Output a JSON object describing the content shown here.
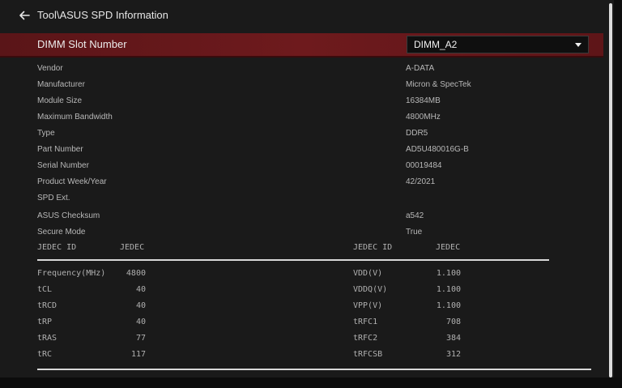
{
  "header": {
    "title": "Tool\\ASUS SPD Information"
  },
  "slot": {
    "label": "DIMM Slot Number",
    "selected": "DIMM_A2"
  },
  "info": [
    {
      "label": "Vendor",
      "value": "A-DATA"
    },
    {
      "label": "Manufacturer",
      "value": "Micron & SpecTek"
    },
    {
      "label": "Module Size",
      "value": "16384MB"
    },
    {
      "label": "Maximum Bandwidth",
      "value": "4800MHz"
    },
    {
      "label": "Type",
      "value": "DDR5"
    },
    {
      "label": "Part Number",
      "value": "AD5U480016G-B"
    },
    {
      "label": "Serial Number",
      "value": "00019484"
    },
    {
      "label": "Product Week/Year",
      "value": "42/2021"
    },
    {
      "label": "SPD Ext.",
      "value": ""
    },
    {
      "label": "ASUS Checksum",
      "value": "a542"
    },
    {
      "label": "Secure Mode",
      "value": "True"
    }
  ],
  "timing": {
    "left_header": {
      "id": "JEDEC ID",
      "col": "JEDEC"
    },
    "right_header": {
      "id": "JEDEC ID",
      "col": "JEDEC"
    },
    "left_rows": [
      {
        "name": "Frequency(MHz)",
        "value": "4800"
      },
      {
        "name": "tCL",
        "value": "40"
      },
      {
        "name": "tRCD",
        "value": "40"
      },
      {
        "name": "tRP",
        "value": "40"
      },
      {
        "name": "tRAS",
        "value": "77"
      },
      {
        "name": "tRC",
        "value": "117"
      }
    ],
    "right_rows": [
      {
        "name": "VDD(V)",
        "value": "1.100"
      },
      {
        "name": "VDDQ(V)",
        "value": "1.100"
      },
      {
        "name": "VPP(V)",
        "value": "1.100"
      },
      {
        "name": "tRFC1",
        "value": "708"
      },
      {
        "name": "tRFC2",
        "value": "384"
      },
      {
        "name": "tRFCSB",
        "value": "312"
      }
    ]
  }
}
